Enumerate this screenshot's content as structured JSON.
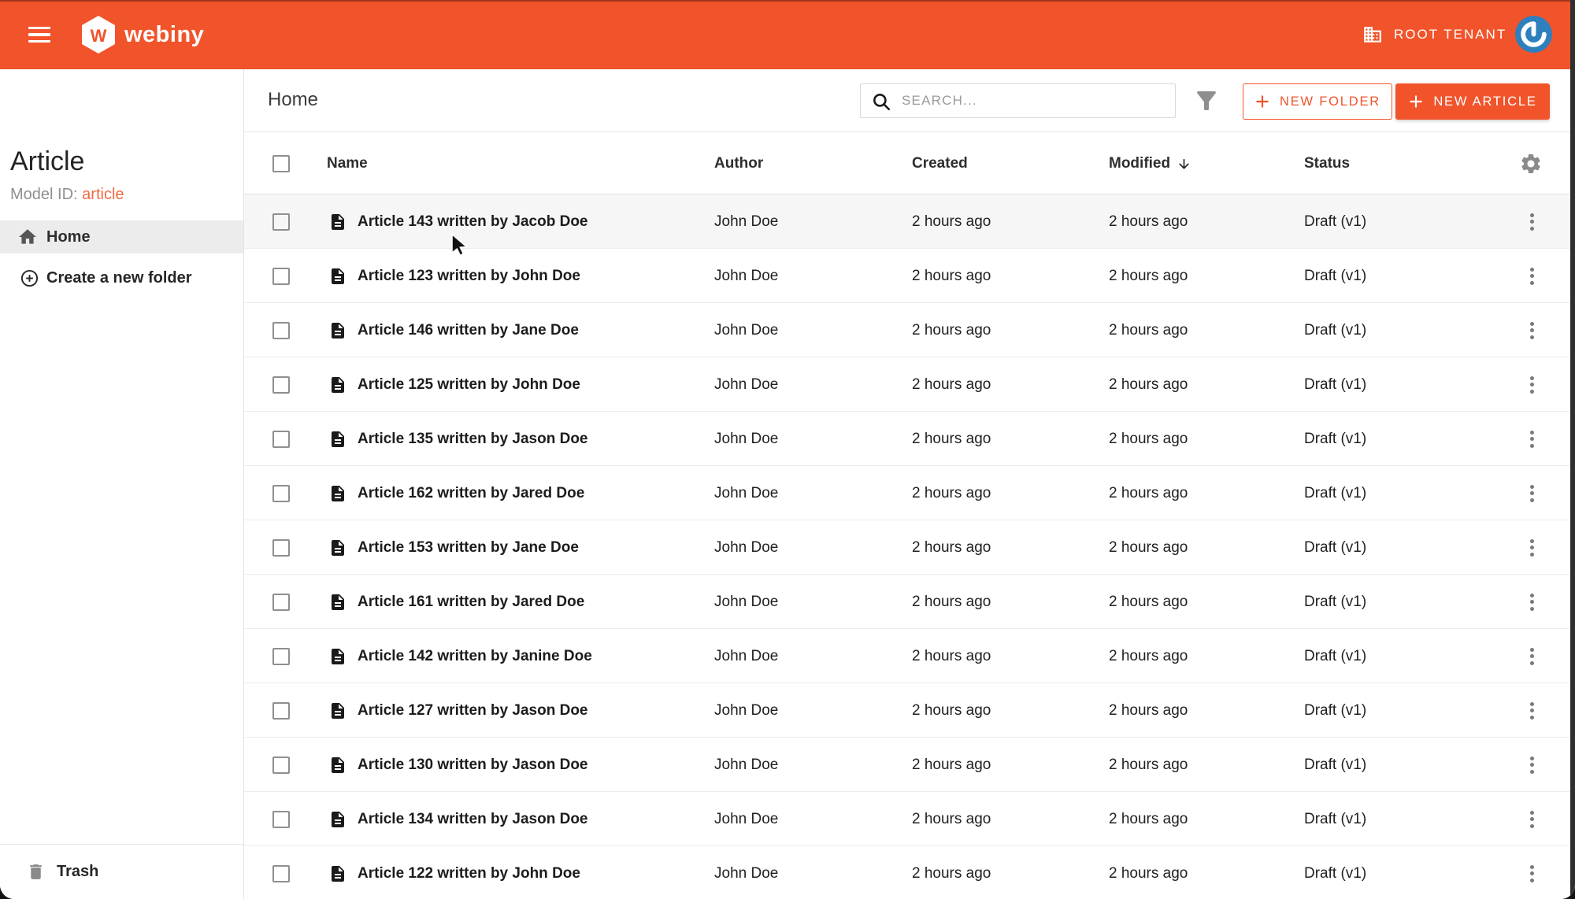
{
  "colors": {
    "accent": "#F1542B",
    "model_id_value": "#EF6B42",
    "avatar_blue": "#2E7FBE"
  },
  "topbar": {
    "brand": "webiny",
    "tenant_label": "ROOT TENANT"
  },
  "sidebar": {
    "title": "Article",
    "model_id_label": "Model ID: ",
    "model_id_value": "article",
    "home_label": "Home",
    "create_folder_label": "Create a new folder",
    "trash_label": "Trash"
  },
  "main": {
    "breadcrumb": "Home",
    "search_placeholder": "SEARCH...",
    "new_folder_label": "NEW FOLDER",
    "new_article_label": "NEW ARTICLE"
  },
  "table": {
    "columns": [
      "Name",
      "Author",
      "Created",
      "Modified",
      "Status"
    ],
    "sort": {
      "column": "Modified",
      "direction": "desc"
    },
    "rows": [
      {
        "name": "Article 143 written by Jacob Doe",
        "author": "John Doe",
        "created": "2 hours ago",
        "modified": "2 hours ago",
        "status": "Draft (v1)",
        "hovered": true
      },
      {
        "name": "Article 123 written by John Doe",
        "author": "John Doe",
        "created": "2 hours ago",
        "modified": "2 hours ago",
        "status": "Draft (v1)",
        "hovered": false
      },
      {
        "name": "Article 146 written by Jane Doe",
        "author": "John Doe",
        "created": "2 hours ago",
        "modified": "2 hours ago",
        "status": "Draft (v1)",
        "hovered": false
      },
      {
        "name": "Article 125 written by John Doe",
        "author": "John Doe",
        "created": "2 hours ago",
        "modified": "2 hours ago",
        "status": "Draft (v1)",
        "hovered": false
      },
      {
        "name": "Article 135 written by Jason Doe",
        "author": "John Doe",
        "created": "2 hours ago",
        "modified": "2 hours ago",
        "status": "Draft (v1)",
        "hovered": false
      },
      {
        "name": "Article 162 written by Jared Doe",
        "author": "John Doe",
        "created": "2 hours ago",
        "modified": "2 hours ago",
        "status": "Draft (v1)",
        "hovered": false
      },
      {
        "name": "Article 153 written by Jane Doe",
        "author": "John Doe",
        "created": "2 hours ago",
        "modified": "2 hours ago",
        "status": "Draft (v1)",
        "hovered": false
      },
      {
        "name": "Article 161 written by Jared Doe",
        "author": "John Doe",
        "created": "2 hours ago",
        "modified": "2 hours ago",
        "status": "Draft (v1)",
        "hovered": false
      },
      {
        "name": "Article 142 written by Janine Doe",
        "author": "John Doe",
        "created": "2 hours ago",
        "modified": "2 hours ago",
        "status": "Draft (v1)",
        "hovered": false
      },
      {
        "name": "Article 127 written by Jason Doe",
        "author": "John Doe",
        "created": "2 hours ago",
        "modified": "2 hours ago",
        "status": "Draft (v1)",
        "hovered": false
      },
      {
        "name": "Article 130 written by Jason Doe",
        "author": "John Doe",
        "created": "2 hours ago",
        "modified": "2 hours ago",
        "status": "Draft (v1)",
        "hovered": false
      },
      {
        "name": "Article 134 written by Jason Doe",
        "author": "John Doe",
        "created": "2 hours ago",
        "modified": "2 hours ago",
        "status": "Draft (v1)",
        "hovered": false
      },
      {
        "name": "Article 122 written by John Doe",
        "author": "John Doe",
        "created": "2 hours ago",
        "modified": "2 hours ago",
        "status": "Draft (v1)",
        "hovered": false
      }
    ]
  }
}
